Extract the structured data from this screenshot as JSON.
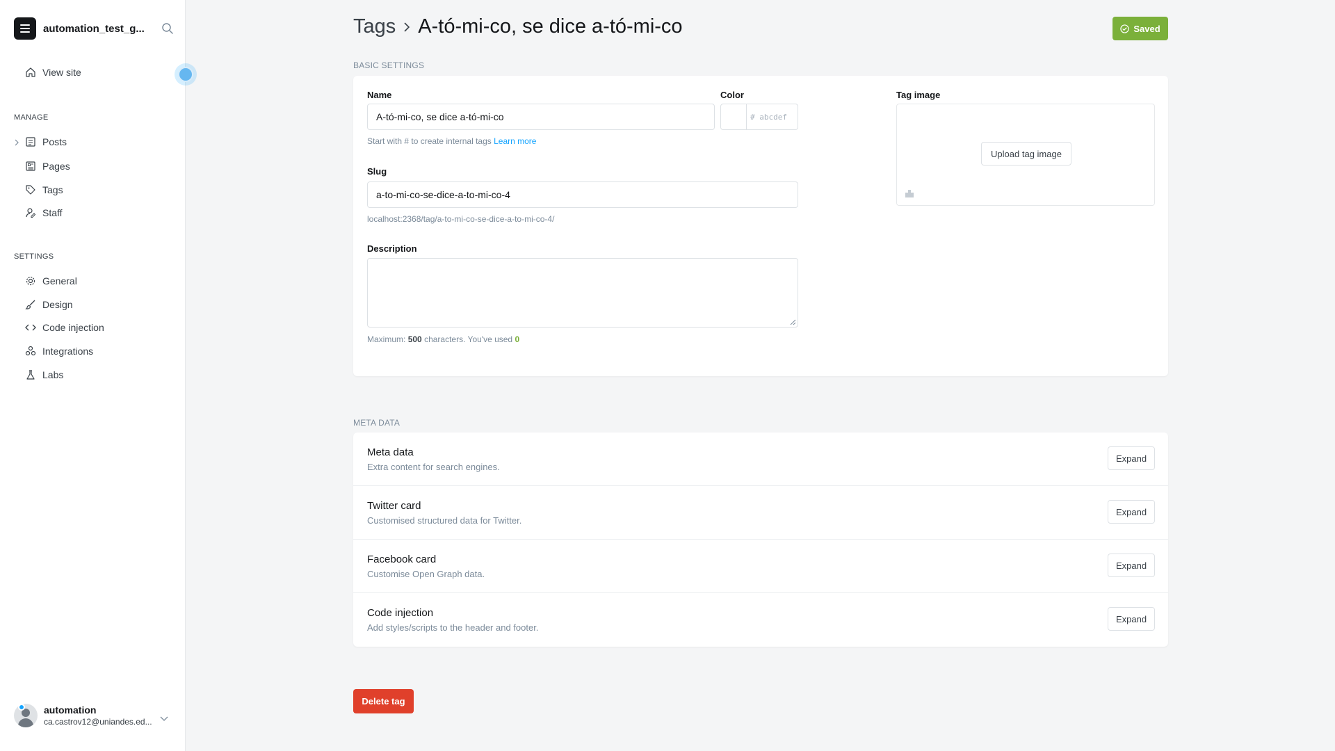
{
  "sidebar": {
    "site_name": "automation_test_g...",
    "view_site": "View site",
    "manage_heading": "MANAGE",
    "manage_items": [
      {
        "label": "Posts",
        "icon": "posts-icon"
      },
      {
        "label": "Pages",
        "icon": "pages-icon"
      },
      {
        "label": "Tags",
        "icon": "tag-icon"
      },
      {
        "label": "Staff",
        "icon": "staff-icon"
      }
    ],
    "settings_heading": "SETTINGS",
    "settings_items": [
      {
        "label": "General",
        "icon": "gear-icon"
      },
      {
        "label": "Design",
        "icon": "brush-icon"
      },
      {
        "label": "Code injection",
        "icon": "code-icon"
      },
      {
        "label": "Integrations",
        "icon": "integrations-icon"
      },
      {
        "label": "Labs",
        "icon": "flask-icon"
      }
    ],
    "user": {
      "name": "automation",
      "email": "ca.castrov12@uniandes.ed..."
    }
  },
  "header": {
    "breadcrumb_parent": "Tags",
    "title": "A-tó-mi-co, se dice a-tó-mi-co",
    "saved_label": "Saved"
  },
  "basic": {
    "section_label": "BASIC SETTINGS",
    "name_label": "Name",
    "name_value": "A-tó-mi-co, se dice a-tó-mi-co",
    "name_hint": "Start with # to create internal tags",
    "learn_more": "Learn more",
    "color_label": "Color",
    "color_placeholder": "# abcdef",
    "slug_label": "Slug",
    "slug_value": "a-to-mi-co-se-dice-a-to-mi-co-4",
    "slug_url": "localhost:2368/tag/a-to-mi-co-se-dice-a-to-mi-co-4/",
    "description_label": "Description",
    "max_prefix": "Maximum:",
    "max_value": "500",
    "max_suffix": "characters. You've used",
    "used_value": "0",
    "tag_image_label": "Tag image",
    "upload_label": "Upload tag image"
  },
  "meta": {
    "section_label": "META DATA",
    "rows": [
      {
        "title": "Meta data",
        "desc": "Extra content for search engines.",
        "button": "Expand"
      },
      {
        "title": "Twitter card",
        "desc": "Customised structured data for Twitter.",
        "button": "Expand"
      },
      {
        "title": "Facebook card",
        "desc": "Customise Open Graph data.",
        "button": "Expand"
      },
      {
        "title": "Code injection",
        "desc": "Add styles/scripts to the header and footer.",
        "button": "Expand"
      }
    ]
  },
  "delete_label": "Delete tag",
  "colors": {
    "saved": "#7bb03a",
    "delete": "#e0402b",
    "link": "#14a4ff",
    "used_count": "#7bb03a"
  }
}
